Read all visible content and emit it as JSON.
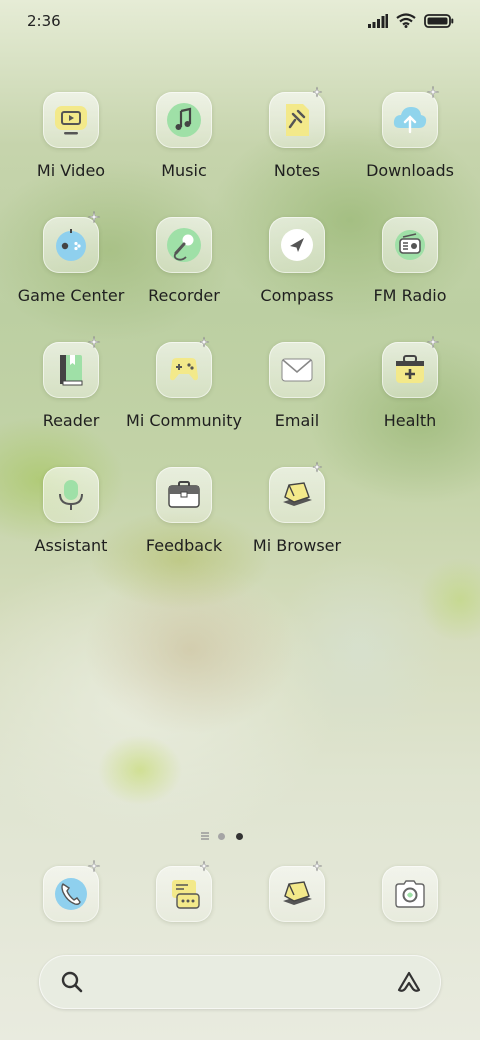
{
  "status_bar": {
    "time": "2:36"
  },
  "apps": [
    {
      "label": "Mi Video",
      "icon": "mi-video-icon"
    },
    {
      "label": "Music",
      "icon": "music-icon"
    },
    {
      "label": "Notes",
      "icon": "notes-icon"
    },
    {
      "label": "Downloads",
      "icon": "downloads-icon"
    },
    {
      "label": "Game Center",
      "icon": "game-center-icon"
    },
    {
      "label": "Recorder",
      "icon": "recorder-icon"
    },
    {
      "label": "Compass",
      "icon": "compass-icon"
    },
    {
      "label": "FM Radio",
      "icon": "fm-radio-icon"
    },
    {
      "label": "Reader",
      "icon": "reader-icon"
    },
    {
      "label": "Mi Community",
      "icon": "mi-community-icon"
    },
    {
      "label": "Email",
      "icon": "email-icon"
    },
    {
      "label": "Health",
      "icon": "health-icon"
    },
    {
      "label": "Assistant",
      "icon": "assistant-icon"
    },
    {
      "label": "Feedback",
      "icon": "feedback-icon"
    },
    {
      "label": "Mi Browser",
      "icon": "mi-browser-icon"
    }
  ],
  "page_indicator": {
    "pages": 3,
    "current": 3
  },
  "dock": [
    {
      "icon": "phone-icon"
    },
    {
      "icon": "messages-icon"
    },
    {
      "icon": "browser-icon"
    },
    {
      "icon": "camera-icon"
    }
  ],
  "colors": {
    "accent_yellow": "#f2e77a",
    "accent_green": "#a8e3a0",
    "accent_blue": "#8fd0ee",
    "label": "#1f1f1f"
  }
}
